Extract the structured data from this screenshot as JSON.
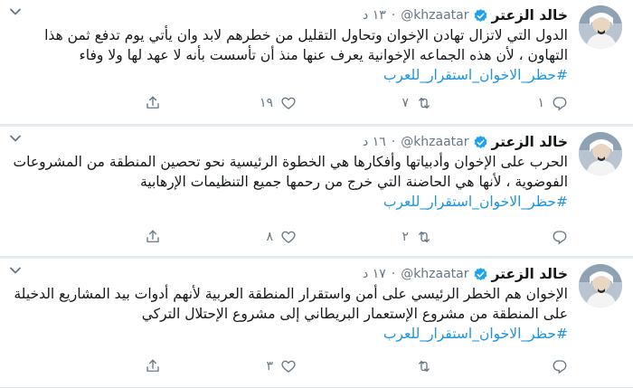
{
  "tweets": [
    {
      "author_name": "خالد الزعتر",
      "handle": "@khzaatar",
      "separator": "·",
      "time": "١٣ د",
      "text": "الدول التي لاتزال تهادن الإخوان وتحاول التقليل من خطرهم لابد وان يأتي يوم تدفع ثمن هذا التهاون ، لأن هذه الجماعه الإخوانية يعرف عنها منذ أن تأسست بأنه لا عهد لها ولا وفاء",
      "hashtag": "#حظر_الاخوان_استقرار_للعرب",
      "replies": "١",
      "retweets": "٧",
      "likes": "١٩"
    },
    {
      "author_name": "خالد الزعتر",
      "handle": "@khzaatar",
      "separator": "·",
      "time": "١٦ د",
      "text": "الحرب على الإخوان وأدبياتها وأفكارها هي الخطوة الرئيسية نحو تحصين المنطقة من المشروعات الفوضوية ، لأنها هي الحاضنة التي خرج من رحمها جميع التنظيمات الإرهابية",
      "hashtag": "#حظر_الاخوان_استقرار_للعرب",
      "replies": "",
      "retweets": "٢",
      "likes": "٨"
    },
    {
      "author_name": "خالد الزعتر",
      "handle": "@khzaatar",
      "separator": "·",
      "time": "١٧ د",
      "text": "الإخوان هم الخطر الرئيسي على أمن واستقرار المنطقة العربية لأنهم أدوات بيد المشاريع الدخيلة على المنطقة من مشروع الإستعمار البريطاني إلى مشروع الإحتلال التركي",
      "hashtag": "#حظر_الاخوان_استقرار_للعرب",
      "replies": "",
      "retweets": "",
      "likes": "٣"
    }
  ],
  "icons": {
    "verified": "verified-badge-icon",
    "caret": "chevron-down-icon",
    "reply": "reply-icon",
    "retweet": "retweet-icon",
    "like": "heart-icon",
    "share": "share-icon"
  },
  "colors": {
    "link": "#1b95e0",
    "verified": "#1da1f2",
    "muted": "#657786",
    "text": "#14171a"
  }
}
